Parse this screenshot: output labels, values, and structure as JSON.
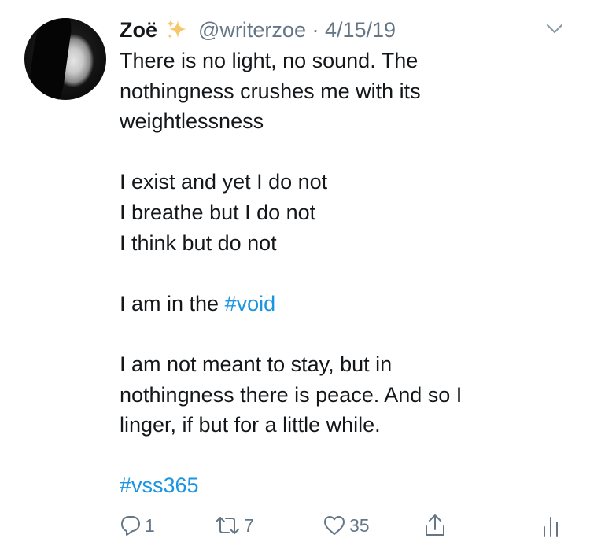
{
  "tweet": {
    "author_name": "Zoë",
    "handle_date": "@writerzoe · 4/15/19",
    "lines": [
      "There is no light, no sound. The",
      "nothingness crushes me with its",
      "weightlessness",
      "",
      "I exist and yet I do not",
      "I breathe but I do not",
      "I think but do not",
      "",
      "I am in the ",
      "",
      "I am not meant to stay, but in",
      "nothingness there is peace. And so I",
      "linger, if but for a little while.",
      ""
    ],
    "hashtag_void": "#void",
    "hashtag_vss": "#vss365",
    "replies": "1",
    "retweets": "7",
    "likes": "35"
  },
  "colors": {
    "link": "#1b95e0",
    "muted": "#657786",
    "text": "#14171a",
    "sparkle": "#f5c96b"
  },
  "icons": [
    "sparkles-icon",
    "chevron-down-icon",
    "reply-icon",
    "retweet-icon",
    "like-icon",
    "share-icon",
    "analytics-icon"
  ]
}
